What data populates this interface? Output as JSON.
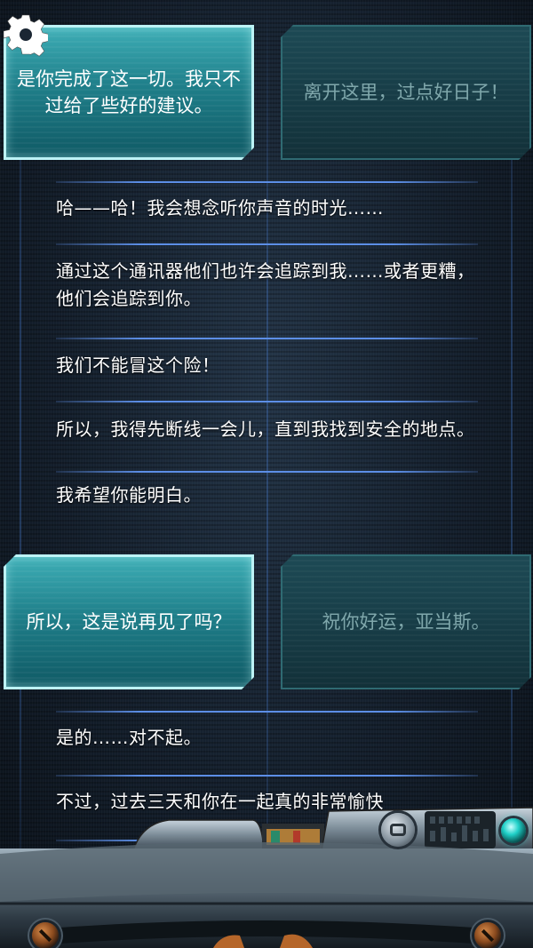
{
  "choices_top": {
    "left": "是你完成了这一切。我只不过给了些好的建议。",
    "right": "离开这里，过点好日子！"
  },
  "messages_a": [
    "哈——哈！我会想念听你声音的时光……",
    "通过这个通讯器他们也许会追踪到我……或者更糟，他们会追踪到你。",
    "我们不能冒这个险！",
    "所以，我得先断线一会儿，直到我找到安全的地点。",
    "我希望你能明白。"
  ],
  "choices_bottom": {
    "left": "所以，这是说再见了吗？",
    "right": "祝你好运，亚当斯。"
  },
  "messages_b": [
    "是的……对不起。",
    "不过，过去三天和你在一起真的非常愉快"
  ],
  "icons": {
    "settings": "gear-icon",
    "console_button": "lock-dial-icon",
    "indicator": "status-light-icon"
  },
  "colors": {
    "choice_active": "#1f7f8a",
    "choice_dim": "#173c46",
    "separator": "#5c8ee6",
    "text": "#ffffff"
  }
}
